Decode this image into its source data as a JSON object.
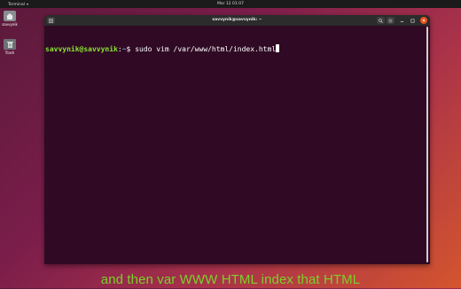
{
  "topbar": {
    "app_name": "Terminal",
    "clock": "Mar 12 01:07"
  },
  "desktop": {
    "icons": [
      {
        "label": "savvynik",
        "icon": "home-folder-icon"
      },
      {
        "label": "Trash",
        "icon": "trash-icon"
      }
    ]
  },
  "window": {
    "title": "savvynik@savvynik: ~",
    "buttons": [
      "new-tab-icon",
      "search-icon",
      "menu-icon",
      "minimize-icon",
      "maximize-icon",
      "close-icon"
    ]
  },
  "terminal": {
    "user_host": "savvynik@savvynik",
    "separator": ":",
    "path": "~",
    "prompt_symbol": "$ ",
    "command": "sudo vim /var/www/html/index.html"
  },
  "caption": "and then var WWW HTML index that HTML",
  "colors": {
    "terminal_bg": "#300a24",
    "prompt_green": "#8ae234",
    "prompt_blue": "#729fcf",
    "caption_green": "#7ad12a",
    "close_orange": "#e95420"
  }
}
